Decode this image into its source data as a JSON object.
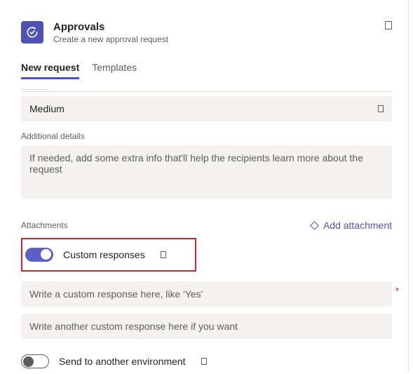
{
  "header": {
    "app_name": "Approvals",
    "app_subtitle": "Create a new approval request"
  },
  "tabs": {
    "new_request": "New request",
    "templates": "Templates"
  },
  "priority": {
    "value": "Medium"
  },
  "details": {
    "label": "Additional details",
    "placeholder": "If needed, add some extra info that'll help the recipients learn more about the request"
  },
  "attachments": {
    "label": "Attachments",
    "add_label": "Add attachment"
  },
  "custom_responses": {
    "label": "Custom responses",
    "response1_placeholder": "Write a custom response here, like 'Yes'",
    "response2_placeholder": "Write another custom response here if you want"
  },
  "send_env": {
    "label": "Send to another environment"
  }
}
